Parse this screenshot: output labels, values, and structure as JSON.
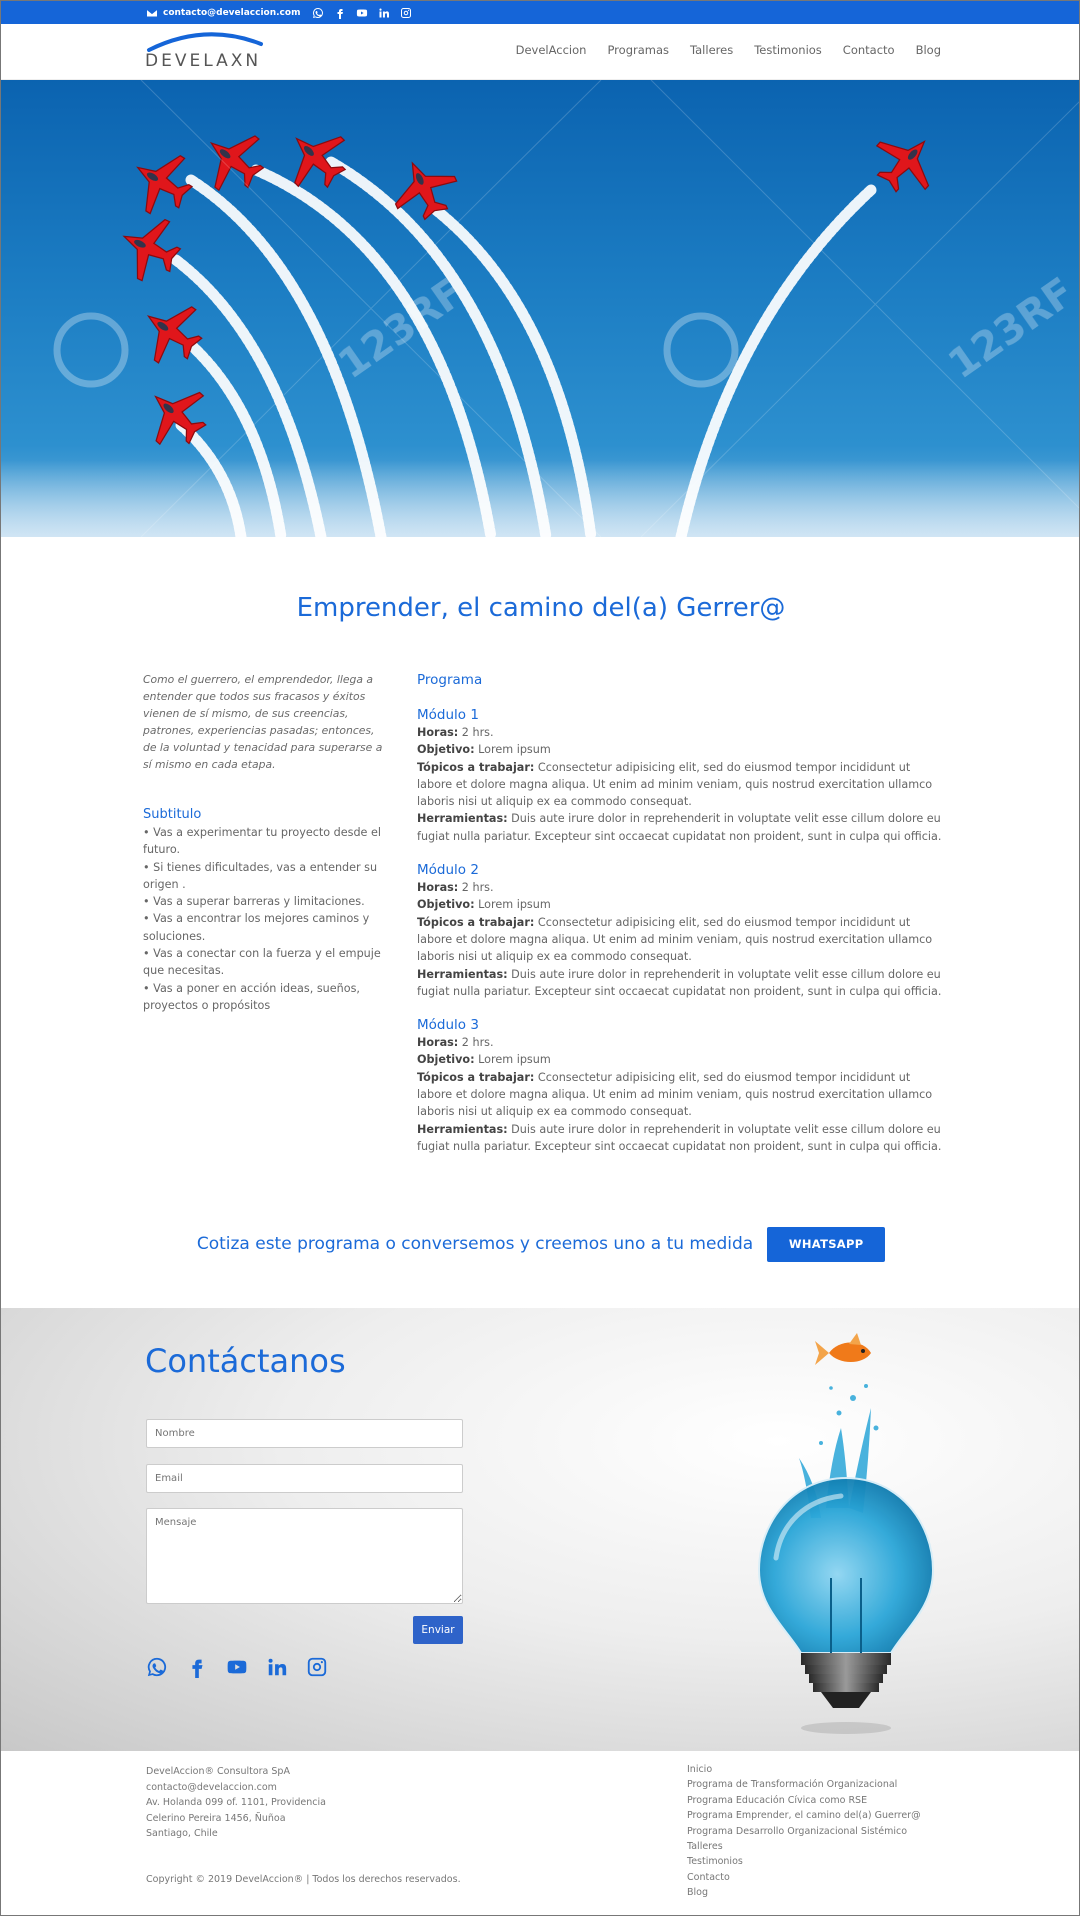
{
  "topbar": {
    "email": "contacto@develaccion.com",
    "social_icons": [
      "whatsapp-icon",
      "facebook-icon",
      "youtube-icon",
      "linkedin-icon",
      "instagram-icon"
    ]
  },
  "header": {
    "logo_text": "DEVELAXN",
    "nav": [
      "DevelAccion",
      "Programas",
      "Talleres",
      "Testimonios",
      "Contacto",
      "Blog"
    ]
  },
  "hero": {
    "watermark": "123RF"
  },
  "main": {
    "title": "Emprender, el camino del(a) Gerrer@",
    "intro": "Como el guerrero, el emprendedor, llega a entender que todos sus fracasos y éxitos vienen de sí mismo, de sus creencias, patrones, experiencias pasadas; entonces, de la voluntad y tenacidad para superarse a sí mismo en cada etapa.",
    "subtitle": "Subtitulo",
    "bullets": [
      "• Vas a experimentar tu proyecto desde el futuro.",
      "• Si tienes dificultades, vas a entender su origen .",
      "• Vas a superar barreras y limitaciones.",
      "• Vas a encontrar los mejores caminos y soluciones.",
      "• Vas a conectar con la fuerza y el empuje que necesitas.",
      "• Vas a poner en acción ideas, sueños, proyectos o propósitos"
    ],
    "program_title": "Programa",
    "modules": [
      {
        "title": "Módulo 1",
        "horas_label": "Horas:",
        "horas": " 2 hrs.",
        "objetivo_label": "Objetivo:",
        "objetivo": "  Lorem ipsum",
        "topicos_label": "Tópicos a trabajar:",
        "topicos": " Cconsectetur adipisicing elit, sed do eiusmod tempor incididunt ut labore et dolore magna aliqua. Ut enim ad minim veniam, quis nostrud exercitation ullamco laboris nisi ut aliquip ex ea commodo consequat.",
        "herramientas_label": "Herramientas:",
        "herramientas": " Duis aute irure dolor in reprehenderit in voluptate velit esse cillum dolore eu fugiat nulla pariatur. Excepteur sint occaecat cupidatat non proident, sunt in culpa qui officia."
      },
      {
        "title": "Módulo 2",
        "horas_label": "Horas:",
        "horas": " 2 hrs.",
        "objetivo_label": "Objetivo:",
        "objetivo": "  Lorem ipsum",
        "topicos_label": "Tópicos a trabajar:",
        "topicos": " Cconsectetur adipisicing elit, sed do eiusmod tempor incididunt ut labore et dolore magna aliqua. Ut enim ad minim veniam, quis nostrud exercitation ullamco laboris nisi ut aliquip ex ea commodo consequat.",
        "herramientas_label": "Herramientas:",
        "herramientas": " Duis aute irure dolor in reprehenderit in voluptate velit esse cillum dolore eu fugiat nulla pariatur. Excepteur sint occaecat cupidatat non proident, sunt in culpa qui officia."
      },
      {
        "title": "Módulo 3",
        "horas_label": "Horas:",
        "horas": " 2 hrs.",
        "objetivo_label": "Objetivo:",
        "objetivo": "  Lorem ipsum",
        "topicos_label": "Tópicos a trabajar:",
        "topicos": " Cconsectetur adipisicing elit, sed do eiusmod tempor incididunt ut labore et dolore magna aliqua. Ut enim ad minim veniam, quis nostrud exercitation ullamco laboris nisi ut aliquip ex ea commodo consequat.",
        "herramientas_label": "Herramientas:",
        "herramientas": " Duis aute irure dolor in reprehenderit in voluptate velit esse cillum dolore eu fugiat nulla pariatur. Excepteur sint occaecat cupidatat non proident, sunt in culpa qui officia."
      }
    ]
  },
  "cta": {
    "text": "Cotiza este programa o conversemos y creemos uno a tu medida",
    "button": "WHATSAPP"
  },
  "contact": {
    "title": "Contáctanos",
    "name_placeholder": "Nombre",
    "email_placeholder": "Email",
    "message_placeholder": "Mensaje",
    "send_label": "Enviar",
    "social_icons": [
      "whatsapp-icon",
      "facebook-icon",
      "youtube-icon",
      "linkedin-icon",
      "instagram-icon"
    ]
  },
  "footer": {
    "info": [
      "DevelAccion® Consultora SpA",
      "contacto@develaccion.com",
      "Av. Holanda 099 of. 1101, Providencia",
      "Celerino Pereira 1456, Ñuñoa",
      "Santiago, Chile"
    ],
    "copyright": "Copyright © 2019 DevelAccion® | Todos los derechos reservados.",
    "links": [
      "Inicio",
      "Programa de Transformación Organizacional",
      "Programa Educación Cívica como RSE",
      "Programa Emprender, el camino del(a) Guerrer@",
      "Programa Desarrollo Organizacional Sistémico",
      "Talleres",
      "Testimonios",
      "Contacto",
      "Blog"
    ]
  },
  "colors": {
    "brand_blue": "#1565d8",
    "heading_blue": "#1b6ad8",
    "plane_red": "#e0161b"
  }
}
